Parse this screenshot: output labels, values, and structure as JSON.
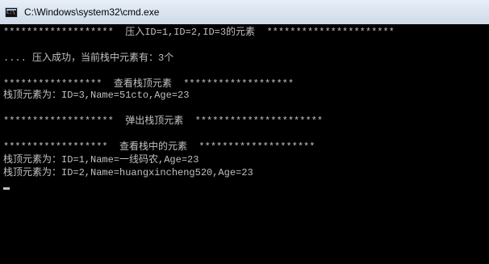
{
  "window": {
    "title": "C:\\Windows\\system32\\cmd.exe",
    "icon": "cmd-icon"
  },
  "console": {
    "lines": [
      "*******************  压入ID=1,ID=2,ID=3的元素  **********************",
      "",
      ".... 压入成功，当前栈中元素有：3个",
      "",
      "*****************  查看栈顶元素  *******************",
      "栈顶元素为：ID=3,Name=51cto,Age=23",
      "",
      "*******************  弹出栈顶元素  **********************",
      "",
      "******************  查看栈中的元素  ********************",
      "栈顶元素为：ID=1,Name=一线码农,Age=23",
      "栈顶元素为：ID=2,Name=huangxincheng520,Age=23",
      ""
    ]
  }
}
